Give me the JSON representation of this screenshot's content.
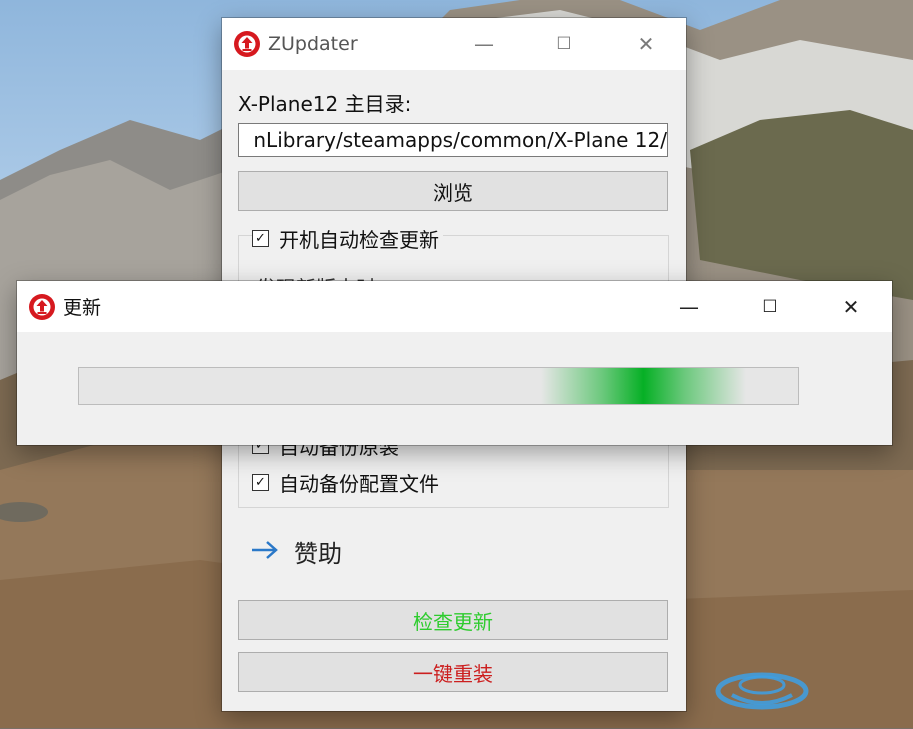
{
  "main_window": {
    "title": "ZUpdater",
    "dir_label": "X-Plane12 主目录:",
    "path_value": "nLibrary/steamapps/common/X-Plane 12/",
    "browse_label": "浏览",
    "auto_check_label": "开机自动检查更新",
    "partially_hidden_text": "发现新版本时",
    "backup_original_label": "自动备份原装",
    "backup_config_label": "自动备份配置文件",
    "sponsor_label": "赞助",
    "check_update_label": "检查更新",
    "reinstall_label": "一键重装",
    "colors": {
      "check_update": "#2ecc2e",
      "reinstall": "#cc1f1f",
      "sponsor_arrow": "#2a78c8"
    }
  },
  "update_window": {
    "title": "更新",
    "progress_style": "marquee-indeterminate",
    "progress_color": "#06b025"
  },
  "window_controls": {
    "minimize": "—",
    "maximize": "☐",
    "close": "✕"
  },
  "icons": {
    "app": "upload-arrow-icon",
    "sponsor": "arrow-right-icon"
  }
}
